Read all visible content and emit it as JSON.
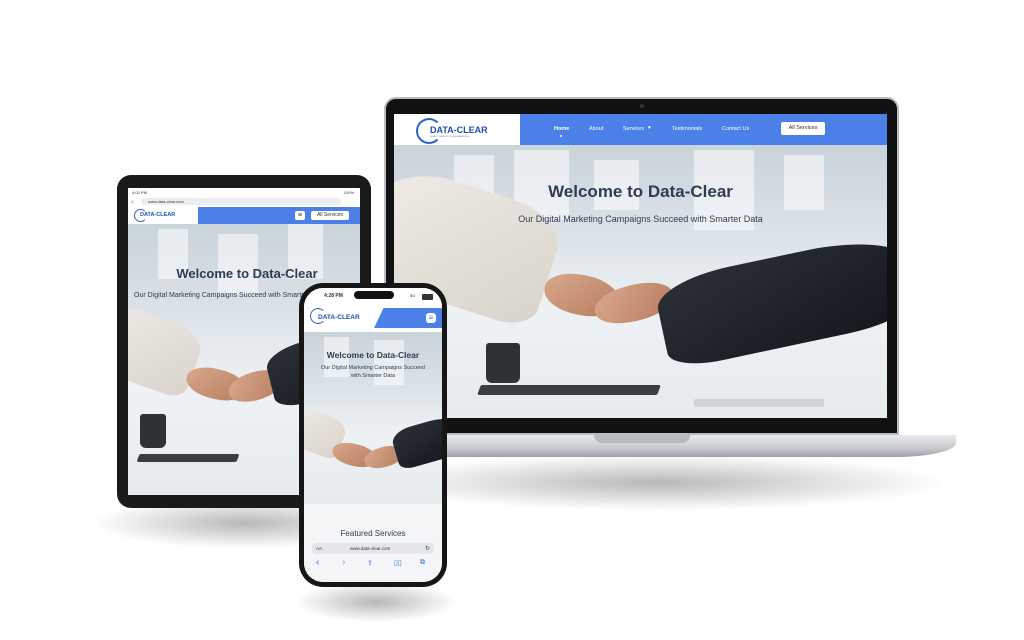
{
  "site": {
    "logo_text": "DATA-CLEAR",
    "logo_tagline": "QUALITY DATA FOR DIGITAL MARKETING",
    "hero_title": "Welcome to Data-Clear",
    "hero_subtitle": "Our Digital Marketing Campaigns Succeed with Smarter Data",
    "all_services_label": "All Services",
    "featured_services": "Featured Services"
  },
  "laptop": {
    "nav": [
      "Home",
      "About",
      "Services",
      "Testimonials",
      "Contact Us"
    ],
    "services_caret": "▾"
  },
  "tablet": {
    "time": "4:02 PM",
    "battery": "100%",
    "url": "www.data-clear.com",
    "menu_icon": "≡"
  },
  "phone": {
    "time": "4:28 PM",
    "signal": "5G",
    "menu_icon": "≡",
    "hero_subtitle_line1": "Our Digital Marketing Campaigns Succeed",
    "hero_subtitle_line2": "with Smarter Data",
    "browser_text_size": "AA",
    "url": "www.data-clear.com",
    "lock_icon": "🔒",
    "reload_icon": "↻",
    "back_icon": "‹",
    "forward_icon": "›",
    "share_icon": "⇪",
    "bookmarks_icon": "📖",
    "tabs_icon": "⧉"
  },
  "colors": {
    "header_blue": "#4a80e8",
    "logo_blue": "#1d4fb4",
    "hero_text": "#2e3d55"
  }
}
